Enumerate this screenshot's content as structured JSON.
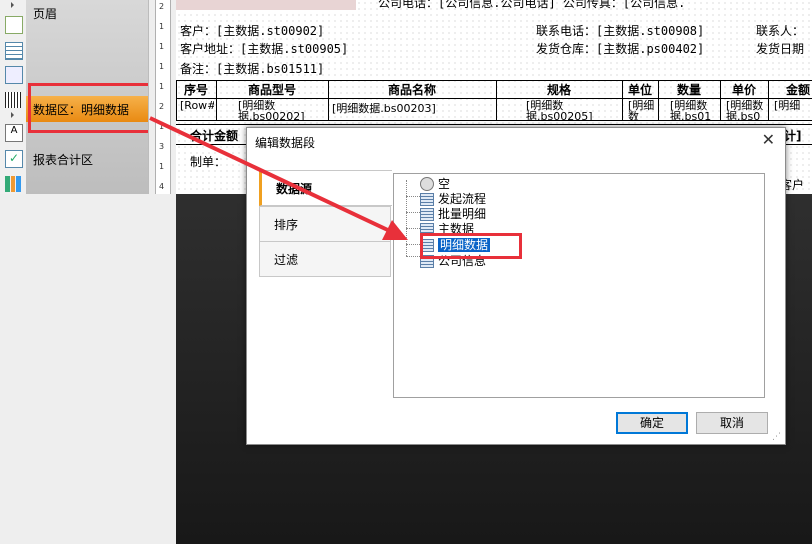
{
  "bands": {
    "header": "页眉",
    "detail": "数据区：明细数据",
    "summary": "报表合计区"
  },
  "ruler_numbers": [
    "2",
    "1",
    "1",
    "1",
    "1",
    "2",
    "1",
    "3",
    "1",
    "4"
  ],
  "toolbar_icon_count": "12",
  "report": {
    "top_line": "公司电话：[公司信息.公司电话]  公司传真：[公司信息.",
    "customer": "客户：[主数据.st00902]",
    "contact_phone": "联系电话：[主数据.st00908]",
    "contact_person": "联系人：",
    "address": "客户地址：[主数据.st00905]",
    "warehouse": "发货仓库：[主数据.ps00402]",
    "ship_date": "发货日期",
    "remark": "备注：[主数据.bs01511]",
    "headers": [
      "序号",
      "商品型号",
      "商品名称",
      "规格",
      "单位",
      "数量",
      "单价",
      "金额"
    ],
    "row": [
      "[Row#]",
      "[明细数据.bs00202]",
      "[明细数据.bs00203]",
      "[明细数据.bs00205]",
      "[明细数据.s",
      "[明细数据.bs01",
      "[明细数据.bs0",
      "[明细"
    ],
    "total_label": "合计金额",
    "total_right": "合计]",
    "maker": "制单：",
    "customer_sign": "客户"
  },
  "dialog": {
    "title": "编辑数据段",
    "tabs": [
      "数据源",
      "排序",
      "过滤"
    ],
    "tree": [
      "空",
      "发起流程",
      "批量明细",
      "主数据",
      "明细数据",
      "公司信息"
    ],
    "selected": "明细数据",
    "ok": "确定",
    "cancel": "取消"
  },
  "colors": {
    "highlight": "#e8303a",
    "selection": "#0a64c8",
    "band_active": "#f0a020"
  }
}
